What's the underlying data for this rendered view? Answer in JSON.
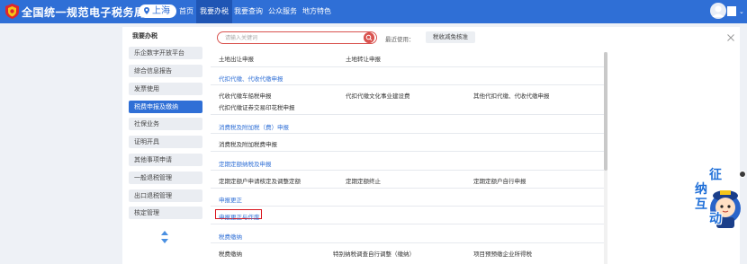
{
  "header": {
    "brand": "全国统一规范电子税务局",
    "region": "上海",
    "nav": [
      {
        "label": "首页",
        "active": false
      },
      {
        "label": "我要办税",
        "active": true
      },
      {
        "label": "我要查询",
        "active": false
      },
      {
        "label": "公众服务",
        "active": false
      },
      {
        "label": "地方特色",
        "active": false
      }
    ],
    "accent_color": "#2f6fd6"
  },
  "sidebar": {
    "title": "我要办税",
    "items": [
      {
        "label": "乐企数字开放平台",
        "active": false
      },
      {
        "label": "综合信息报告",
        "active": false
      },
      {
        "label": "发票使用",
        "active": false
      },
      {
        "label": "税费申报及缴纳",
        "active": true
      },
      {
        "label": "社保业务",
        "active": false
      },
      {
        "label": "证明开具",
        "active": false
      },
      {
        "label": "其他事项申请",
        "active": false
      },
      {
        "label": "一般退税管理",
        "active": false
      },
      {
        "label": "出口退税管理",
        "active": false
      },
      {
        "label": "核定管理",
        "active": false
      }
    ]
  },
  "search": {
    "placeholder": "请输入关键词",
    "recent_label": "最近使用：",
    "recent_items": [
      "税收减免核准"
    ]
  },
  "content": {
    "top_rows": [
      "土地出让申报",
      "土地转让申报"
    ],
    "sections": [
      {
        "title": "代扣代缴、代收代缴申报",
        "rows": [
          [
            "代收代缴车船税申报",
            "代扣代缴文化事业建设费",
            "其他代扣代缴、代收代缴申报"
          ],
          [
            "代扣代缴证券交易印花税申报"
          ]
        ]
      },
      {
        "title": "消费税及附加税（费）申报",
        "rows": [
          [
            "消费税及附加税费申报"
          ]
        ]
      },
      {
        "title": "定期定额纳税及申报",
        "rows": [
          [
            "定期定额户申请核定及调整定额",
            "定期定额终止",
            "定期定额户自行申报"
          ]
        ]
      },
      {
        "title": "申报更正",
        "rows": [
          [
            "申报更正与作废"
          ]
        ]
      },
      {
        "title": "税费缴纳",
        "rows": [
          [
            "税费缴纳",
            "特别纳税调查自行调整（缴纳）",
            "项目预预缴企业所得税"
          ]
        ]
      }
    ],
    "highlighted_item": "申报更正与作废",
    "highlight_color": "#d9141c"
  },
  "mascot": {
    "chars": [
      "征",
      "纳",
      "互",
      "动"
    ]
  }
}
